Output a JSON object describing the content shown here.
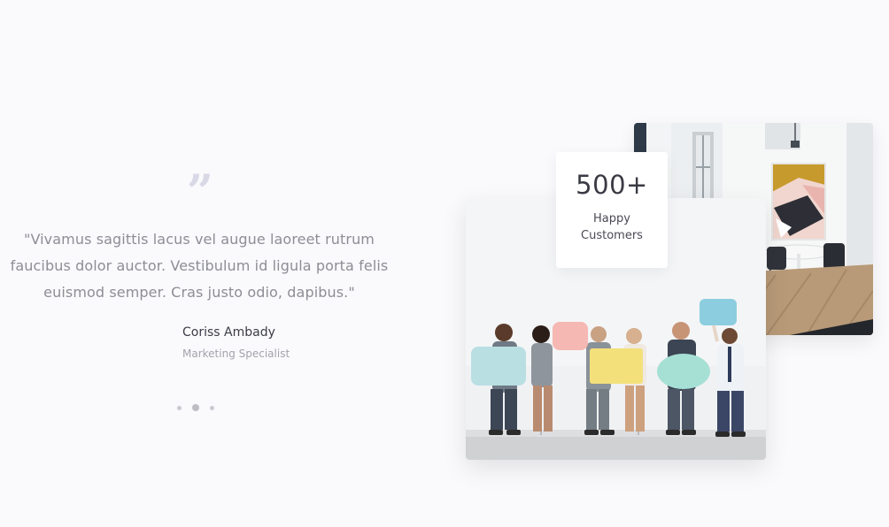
{
  "testimonial": {
    "quote_icon": "quote-icon",
    "text": "\"Vivamus sagittis lacus vel augue laoreet rutrum faucibus dolor auctor. Vestibulum id ligula porta felis euismod semper. Cras justo odio, dapibus.\"",
    "author_name": "Coriss Ambady",
    "author_role": "Marketing Specialist",
    "pagination": {
      "count": 3,
      "active_index": 1
    }
  },
  "stats": {
    "number": "500+",
    "label": "Happy Customers"
  },
  "images": {
    "office": "office-interior-photo",
    "people": "people-holding-speech-bubbles-photo"
  },
  "colors": {
    "background": "#fafafc",
    "quote_mark": "#d9d8e6",
    "body_text": "#8d8d96",
    "heading_text": "#3b3b46"
  }
}
